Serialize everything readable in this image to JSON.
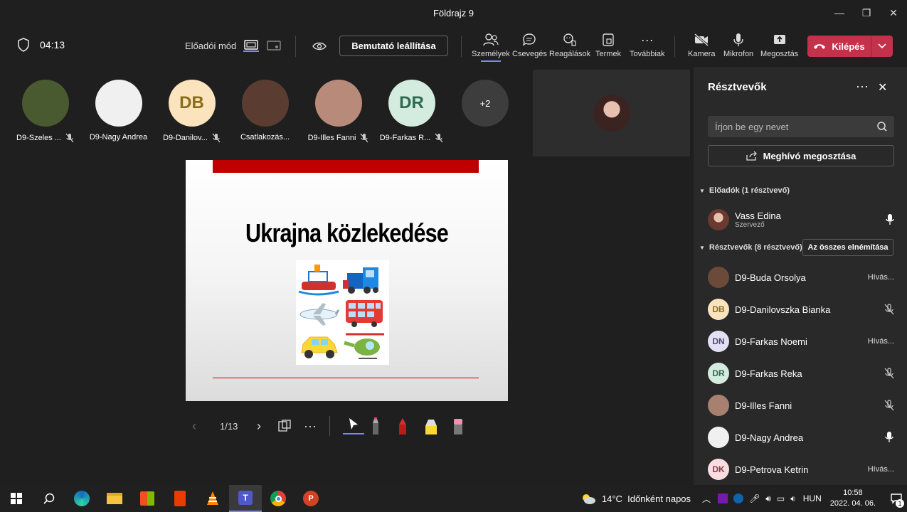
{
  "window": {
    "title": "Földrajz 9"
  },
  "toolbar": {
    "timer": "04:13",
    "presenter_mode_label": "Előadói mód",
    "stop_presenting": "Bemutató leállítása",
    "people": "Személyek",
    "chat": "Csevegés",
    "reactions": "Reagálások",
    "rooms": "Termek",
    "more": "Továbbiak",
    "camera": "Kamera",
    "mic": "Mikrofon",
    "share": "Megosztás",
    "leave": "Kilépés"
  },
  "stage": {
    "participants": [
      {
        "name": "D9-Szeles ...",
        "initials": "",
        "color": "#4a5a30",
        "muted": true
      },
      {
        "name": "D9-Nagy Andrea",
        "initials": "",
        "color": "#f0f0f0",
        "muted": false
      },
      {
        "name": "D9-Danilov...",
        "initials": "DB",
        "color": "#fbe4bd",
        "text": "#8a6d1a",
        "muted": true
      },
      {
        "name": "Csatlakozás...",
        "initials": "",
        "color": "#5a3d30",
        "muted": false
      },
      {
        "name": "D9-Illes Fanni",
        "initials": "",
        "color": "#b88a7a",
        "muted": true
      },
      {
        "name": "D9-Farkas R...",
        "initials": "DR",
        "color": "#d4ebe0",
        "text": "#2d6b50",
        "muted": true
      }
    ],
    "overflow": "+2",
    "slide": {
      "title": "Ukrajna közlekedése",
      "counter": "1/13"
    }
  },
  "panel": {
    "title": "Résztvevők",
    "search_placeholder": "Írjon be egy nevet",
    "invite": "Meghívó megosztása",
    "presenters_section": "Előadók (1 résztvevő)",
    "attendees_section": "Résztvevők (8 résztvevő)",
    "mute_all": "Az összes elnémítása",
    "presenter": {
      "name": "Vass Edina",
      "role": "Szervező"
    },
    "attendees": [
      {
        "name": "D9-Buda Orsolya",
        "initials": "",
        "color": "#6b4a3a",
        "status": "Hívás...",
        "muted": false
      },
      {
        "name": "D9-Danilovszka Bianka",
        "initials": "DB",
        "color": "#fbe4bd",
        "text": "#8a6d1a",
        "status": "",
        "muted": true
      },
      {
        "name": "D9-Farkas Noemi",
        "initials": "DN",
        "color": "#e4e0f4",
        "text": "#4a4a7a",
        "status": "Hívás...",
        "muted": false
      },
      {
        "name": "D9-Farkas Reka",
        "initials": "DR",
        "color": "#d4ebe0",
        "text": "#2d6b50",
        "status": "",
        "muted": true
      },
      {
        "name": "D9-Illes Fanni",
        "initials": "",
        "color": "#a88070",
        "status": "",
        "muted": true
      },
      {
        "name": "D9-Nagy Andrea",
        "initials": "",
        "color": "#f0f0f0",
        "status": "",
        "muted": false,
        "mic": true
      },
      {
        "name": "D9-Petrova Ketrin",
        "initials": "DK",
        "color": "#fadde0",
        "text": "#8a3a4a",
        "status": "Hívás...",
        "muted": false
      }
    ]
  },
  "taskbar": {
    "weather": "14°C  Időnként napos",
    "lang": "HUN",
    "time": "10:58",
    "date": "2022. 04. 06.",
    "notif_count": "1"
  }
}
